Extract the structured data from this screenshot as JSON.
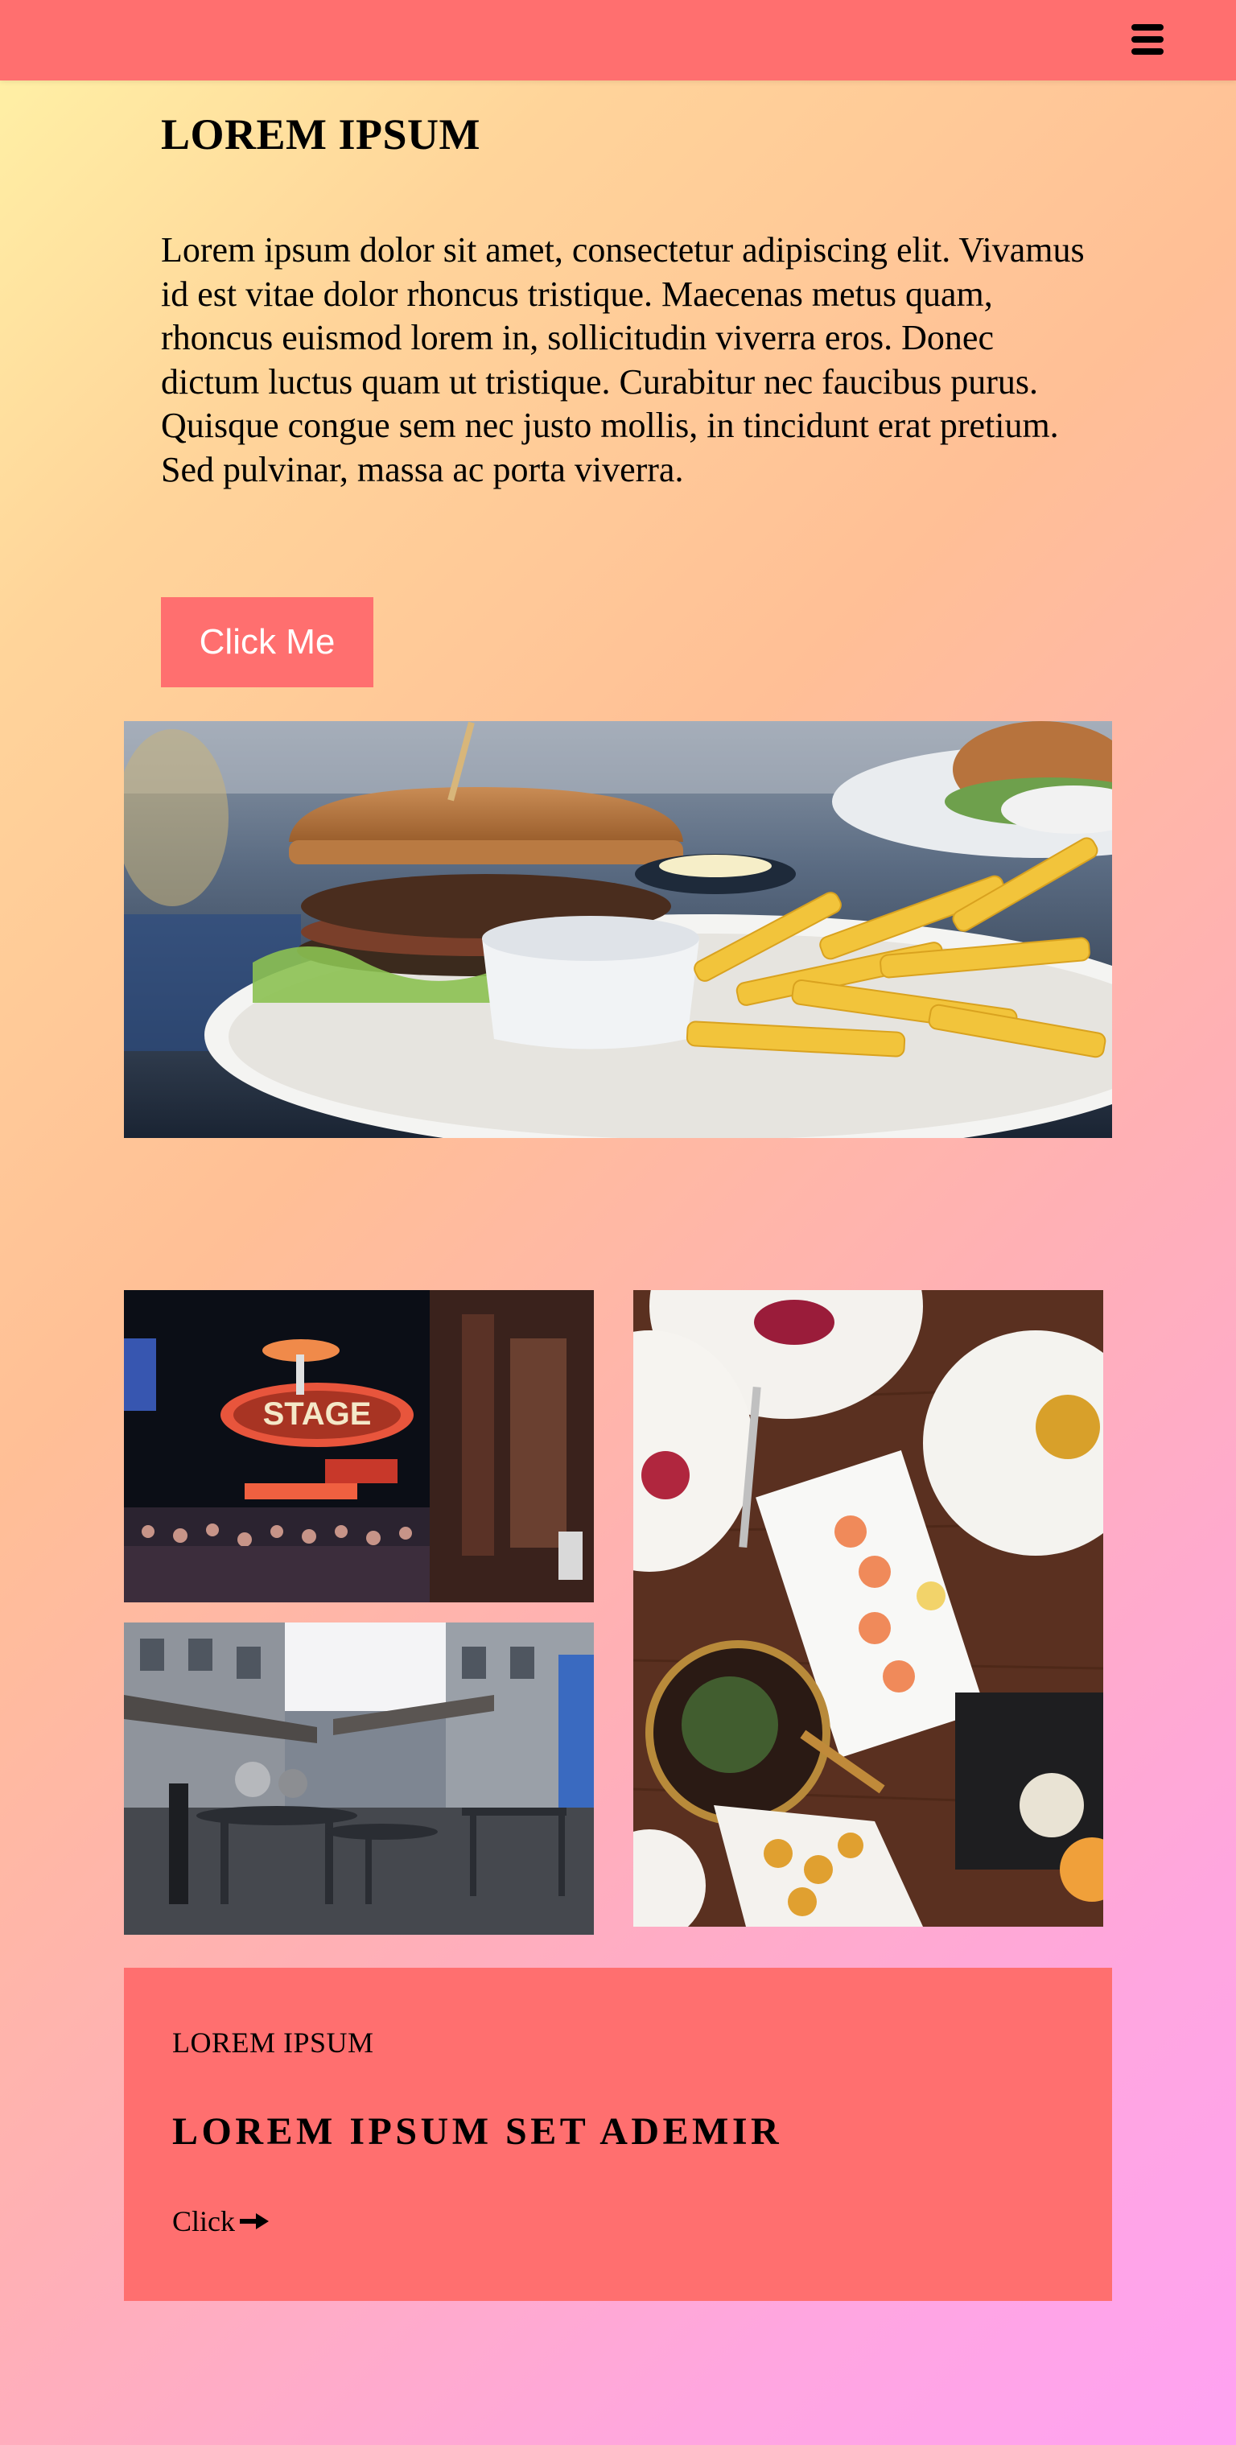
{
  "header": {
    "menu_icon": "hamburger-menu-icon",
    "background": "#ff6f6f"
  },
  "intro": {
    "title": "LOREM IPSUM",
    "body": "Lorem ipsum dolor sit amet, consectetur adipiscing elit. Vivamus id est vitae dolor rhoncus tristique. Maecenas metus quam, rhoncus euismod lorem in, sollicitudin viverra eros. Donec dictum luctus quam ut tristique. Curabitur nec faucibus purus. Quisque congue sem nec justo mollis, in tincidunt erat pretium. Sed pulvinar, massa ac porta viverra.",
    "button_label": "Click Me"
  },
  "gallery": {
    "hero": "burger-and-fries-photo",
    "items": [
      "neon-stage-sign-street-photo",
      "outdoor-cafe-street-photo",
      "shared-dishes-table-photo"
    ]
  },
  "card": {
    "eyebrow": "LOREM IPSUM",
    "heading": "LOREM IPSUM SET ADEMIR",
    "link_label": "Click",
    "link_icon": "arrow-right-icon"
  },
  "colors": {
    "accent": "#ff6f6f",
    "button_text": "#ffffff",
    "gradient_start": "#fff3a6",
    "gradient_end": "#ffa2f2"
  }
}
